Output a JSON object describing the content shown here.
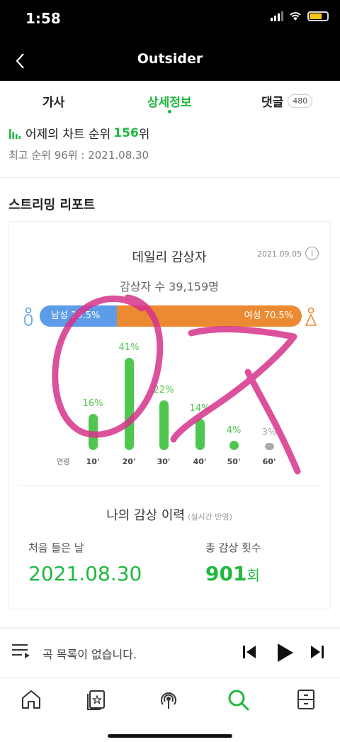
{
  "status": {
    "time": "1:58"
  },
  "nav": {
    "title": "Outsider"
  },
  "tabs": {
    "lyrics": "가사",
    "detail": "상세정보",
    "comments": "댓글",
    "comments_count": "480"
  },
  "rank": {
    "prefix": "어제의 차트 순위",
    "value": "156",
    "suffix": "위",
    "peak": "최고 순위 96위 : 2021.08.30"
  },
  "section_title": "스트리밍 리포트",
  "daily": {
    "title": "데일리 감상자",
    "date": "2021.09.05",
    "listeners": "감상자 수 39,159명",
    "male_label": "남성 29.5%",
    "female_label": "여성 70.5%",
    "male_share": 29.5,
    "age_title": "연령"
  },
  "chart_data": {
    "type": "bar",
    "categories": [
      "10'",
      "20'",
      "30'",
      "40'",
      "50'",
      "60'"
    ],
    "values": [
      16,
      41,
      22,
      14,
      4,
      3
    ],
    "labels": [
      "16%",
      "41%",
      "22%",
      "14%",
      "4%",
      "3%"
    ]
  },
  "history": {
    "title": "나의 감상 이력",
    "note": "(실시간 반영)",
    "first_label": "처음 들은 날",
    "first_value": "2021.08.30",
    "total_label": "총 감상 횟수",
    "total_value": "901",
    "total_unit": "회"
  },
  "player": {
    "queue_text": "곡 목록이 없습니다."
  },
  "colors": {
    "accent": "#1fb93e",
    "male": "#5c9ce8",
    "female": "#ec8a34",
    "bar": "#4fc74f",
    "scribble": "#d6338a"
  }
}
